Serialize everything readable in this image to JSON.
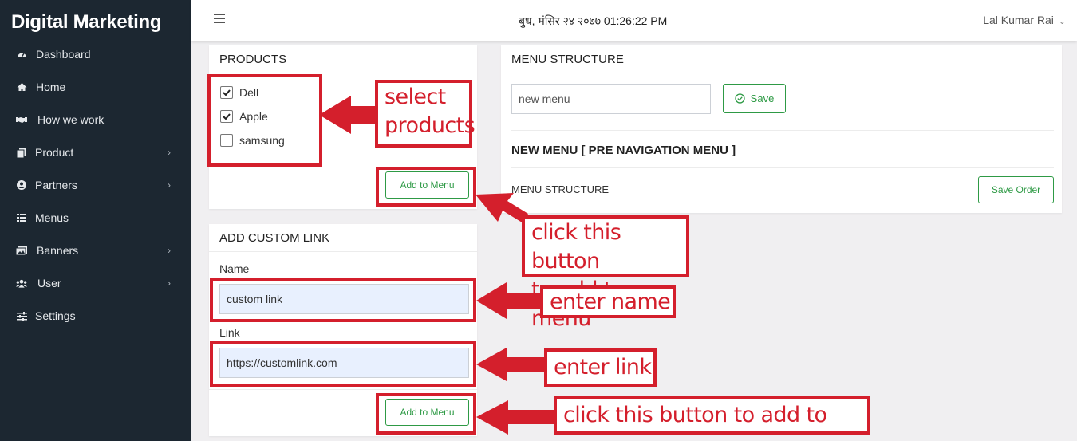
{
  "sidebar": {
    "brand": "Digital Marketing",
    "items": [
      {
        "label": "Dashboard",
        "icon": "dashboard-icon",
        "has_submenu": false
      },
      {
        "label": "Home",
        "icon": "home-icon",
        "has_submenu": false
      },
      {
        "label": "How we work",
        "icon": "handshake-icon",
        "has_submenu": false
      },
      {
        "label": "Product",
        "icon": "copy-icon",
        "has_submenu": true
      },
      {
        "label": "Partners",
        "icon": "user-circle-icon",
        "has_submenu": true
      },
      {
        "label": "Menus",
        "icon": "grid-icon",
        "has_submenu": false
      },
      {
        "label": "Banners",
        "icon": "images-icon",
        "has_submenu": true
      },
      {
        "label": "User",
        "icon": "users-icon",
        "has_submenu": true
      },
      {
        "label": "Settings",
        "icon": "sliders-icon",
        "has_submenu": false
      }
    ],
    "caret": "›"
  },
  "topbar": {
    "datetime": "बुध, मंसिर २४ २०७७ 01:26:22 PM",
    "username": "Lal Kumar Rai",
    "user_caret": "⌄"
  },
  "products": {
    "title": "PRODUCTS",
    "items": [
      {
        "label": "Dell",
        "checked": true
      },
      {
        "label": "Apple",
        "checked": true
      },
      {
        "label": "samsung",
        "checked": false
      }
    ],
    "add_button": "Add to Menu"
  },
  "custom_link": {
    "title": "ADD CUSTOM LINK",
    "name_label": "Name",
    "name_value": "custom link",
    "link_label": "Link",
    "link_value": "https://customlink.com",
    "add_button": "Add to Menu"
  },
  "menu_structure": {
    "title": "MENU STRUCTURE",
    "input_value": "new menu",
    "save_button": "Save",
    "menu_title": "NEW MENU [ PRE NAVIGATION MENU ]",
    "structure_label": "MENU STRUCTURE",
    "save_order_button": "Save Order"
  },
  "annotations": {
    "select_products_1": "select",
    "select_products_2": "products",
    "click_button_1": "click this button",
    "click_button_2": "to add to menu",
    "enter_name": "enter name",
    "enter_link": "enter link",
    "click_button_bottom": "click this button to add to menu"
  },
  "colors": {
    "sidebar_bg": "#1c2731",
    "accent_green": "#2e9a45",
    "annotation_red": "#d41f2c",
    "field_autofill": "#e8f0fe"
  }
}
